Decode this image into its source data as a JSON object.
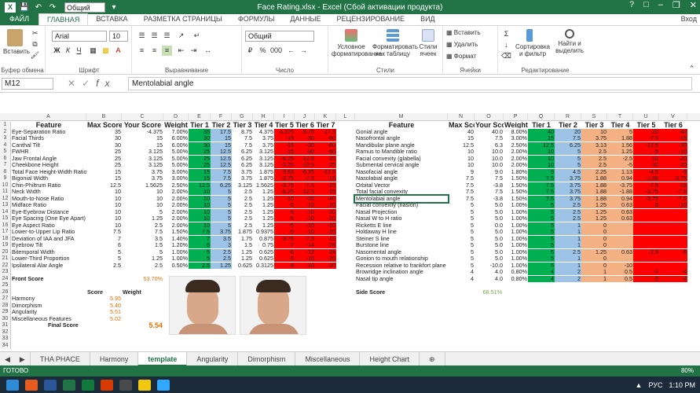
{
  "title": {
    "text": "Face Rating.xlsx - Excel (Сбой активации продукта)",
    "font_name": "Общий"
  },
  "tabs": {
    "file": "ФАЙЛ",
    "home": "ГЛАВНАЯ",
    "insert": "ВСТАВКА",
    "layout": "РАЗМЕТКА СТРАНИЦЫ",
    "formulas": "ФОРМУЛЫ",
    "data": "ДАННЫЕ",
    "review": "РЕЦЕНЗИРОВАНИЕ",
    "view": "ВИД",
    "login": "Вход"
  },
  "ribbon": {
    "paste": "Вставить",
    "clipboard": "Буфер обмена",
    "font_group": "Шрифт",
    "font": "Arial",
    "size": "10",
    "align": "Выравнивание",
    "numfmt": "Общий",
    "number": "Число",
    "cond": "Условное форматирование",
    "table": "Форматировать как таблицу",
    "styles_btn": "Стили ячеек",
    "styles": "Стили",
    "ins": "Вставить",
    "del": "Удалить",
    "fmt": "Формат",
    "cells": "Ячейки",
    "sort": "Сортировка и фильтр",
    "find": "Найти и выделить",
    "edit": "Редактирование"
  },
  "formula_bar": {
    "namebox": "M12",
    "formula": "Mentolabial angle"
  },
  "columns": [
    "A",
    "B",
    "C",
    "D",
    "E",
    "F",
    "G",
    "H",
    "I",
    "J",
    "K",
    "L",
    "M",
    "N",
    "O",
    "P",
    "Q",
    "R",
    "S",
    "T",
    "U",
    "V"
  ],
  "left_headers": [
    "Feature",
    "Max Score",
    "Your Score",
    "Weight",
    "Tier 1",
    "Tier 2",
    "Tier 3",
    "Tier 4",
    "Tier 5",
    "Tier 6",
    "Tier 7"
  ],
  "left_rows": [
    [
      "Eye-Separation Ratio",
      "35",
      "-4.375",
      "7.00%",
      "35",
      "17.5",
      "8.75",
      "4.375",
      "-4.375",
      "-8.75",
      "-17.5"
    ],
    [
      "Facial Thirds",
      "30",
      "15",
      "6.00%",
      "30",
      "15",
      "7.5",
      "3.75",
      "-15",
      "-30",
      "-60"
    ],
    [
      "Canthal Tilt",
      "30",
      "15",
      "6.00%",
      "30",
      "15",
      "7.5",
      "3.75",
      "-15",
      "-30",
      "-60"
    ],
    [
      "FWHR",
      "25",
      "3.125",
      "5.00%",
      "25",
      "12.5",
      "6.25",
      "3.125",
      "-15",
      "-30",
      "-60"
    ],
    [
      "Jaw Frontal Angle",
      "25",
      "3.125",
      "5.00%",
      "25",
      "12.5",
      "6.25",
      "3.125",
      "-6.25",
      "-12.5",
      "-25"
    ],
    [
      "Cheekbone Height",
      "25",
      "3.125",
      "5.00%",
      "25",
      "12.5",
      "6.25",
      "3.125",
      "-3.25",
      "-12.5",
      "-25"
    ],
    [
      "Total Face Height-Width Ratio",
      "15",
      "3.75",
      "3.00%",
      "15",
      "7.5",
      "3.75",
      "1.875",
      "-3.63",
      "-6.25",
      "-12.5"
    ],
    [
      "Bigonial Width",
      "15",
      "3.75",
      "3.00%",
      "15",
      "7.5",
      "3.75",
      "1.875",
      "-3.75",
      "-7.5",
      "-15"
    ],
    [
      "Chin-Philtrum Ratio",
      "12.5",
      "1.5625",
      "2.50%",
      "12.5",
      "6.25",
      "3.125",
      "1.5625",
      "-3.75",
      "-7.5",
      "-15"
    ],
    [
      "Neck Width",
      "10",
      "10",
      "2.00%",
      "10",
      "5",
      "2.5",
      "1.25",
      "-6.25",
      "-12.5",
      "-25"
    ],
    [
      "Mouth-to-Nose Ratio",
      "10",
      "10",
      "2.00%",
      "10",
      "5",
      "2.5",
      "1.25",
      "-10",
      "-20",
      "-40"
    ],
    [
      "Midface Ratio",
      "10",
      "10",
      "2.00%",
      "10",
      "5",
      "2.5",
      "1.25",
      "-5",
      "-10",
      "-20"
    ],
    [
      "Eye-Eyebrow Distance",
      "10",
      "5",
      "2.00%",
      "10",
      "5",
      "2.5",
      "1.25",
      "-5",
      "-10",
      "-20"
    ],
    [
      "Eye Spacing (One Eye Apart)",
      "10",
      "1.25",
      "2.00%",
      "10",
      "5",
      "2.5",
      "1.25",
      "-5",
      "-10",
      "-20"
    ],
    [
      "Eye Aspect Ratio",
      "10",
      "2.5",
      "2.00%",
      "10",
      "5",
      "2.5",
      "1.25",
      "-5",
      "-10",
      "-20"
    ],
    [
      "Lower-to-Upper Lip Ratio",
      "7.5",
      "7.5",
      "1.50%",
      "7.5",
      "3.75",
      "1.875",
      "0.9375",
      "-5",
      "-10",
      "-20"
    ],
    [
      "Deviation of IAA and JFA",
      "7",
      "3.5",
      "1.40%",
      "7",
      "3.5",
      "1.75",
      "0.875",
      "-3.75",
      "-7.5",
      "-15"
    ],
    [
      "Eyebrow Tilt",
      "6",
      "1.5",
      "1.20%",
      "6",
      "3",
      "1.5",
      "0.75",
      "-7",
      "-14",
      "-28"
    ],
    [
      "Bitemporal Width",
      "5",
      "5",
      "1.00%",
      "5",
      "2.5",
      "1.25",
      "0.625",
      "-6",
      "-12",
      "-24"
    ],
    [
      "Lower-Third Proportion",
      "5",
      "1.25",
      "1.00%",
      "5",
      "2.5",
      "1.25",
      "0.625",
      "-5",
      "-10",
      "-20"
    ],
    [
      "Ipsilateral Alar Angle",
      "2.5",
      "2.5",
      "0.50%",
      "2.5",
      "1.25",
      "0.625",
      "0.3125",
      "-5",
      "-10",
      "-20"
    ]
  ],
  "front_score": {
    "label": "Front Score",
    "value": "53.70%"
  },
  "summary": {
    "score_h": "Score",
    "weight_h": "Weight",
    "rows": [
      [
        "Harmony",
        "5.95",
        "35%"
      ],
      [
        "Dimorphism",
        "5.40",
        "20%"
      ],
      [
        "Angularity",
        "5.51",
        "25%"
      ],
      [
        "Miscellaneous Features",
        "5.02",
        "20%"
      ]
    ],
    "final_label": "Final Score",
    "final_value": "5.54"
  },
  "right_headers": [
    "Feature",
    "Max Score",
    "Your Score",
    "Weight",
    "Tier 1",
    "Tier 2",
    "Tier 3",
    "Tier 4",
    "Tier 5",
    "Tier 6"
  ],
  "right_rows": [
    [
      "Gonial angle",
      "40",
      "40.0",
      "8.00%",
      "40",
      "20",
      "10",
      "5",
      "-20",
      "-40"
    ],
    [
      "Nasofrontal angle",
      "15",
      "7.5",
      "3.00%",
      "15",
      "7.5",
      "3.75",
      "1.88",
      "-7.5",
      "-15"
    ],
    [
      "Mandibular plane angle",
      "12.5",
      "6.3",
      "2.50%",
      "12.5",
      "6.25",
      "3.13",
      "1.56",
      "-12.5",
      "-20"
    ],
    [
      "Ramus to Mandible ratio",
      "10",
      "10.0",
      "2.00%",
      "10",
      "5",
      "2.5",
      "1.25",
      "-5",
      "-10"
    ],
    [
      "Facial convexity (glabella)",
      "10",
      "10.0",
      "2.00%",
      "10",
      "5",
      "2.5",
      "-2.5",
      "-10",
      "-20"
    ],
    [
      "Submental cervical angle",
      "10",
      "10.0",
      "2.00%",
      "10",
      "5",
      "2.5",
      "-5",
      "-10",
      "-20"
    ],
    [
      "Nasofacial angle",
      "9",
      "9.0",
      "1.80%",
      "9",
      "4.5",
      "2.25",
      "1.13",
      "-4.5",
      "-9"
    ],
    [
      "Nasolabial angle",
      "7.5",
      "7.5",
      "1.50%",
      "7.5",
      "3.75",
      "1.88",
      "0.94",
      "-1.88",
      "-3.75"
    ],
    [
      "Orbital Vector",
      "7.5",
      "-3.8",
      "1.50%",
      "7.5",
      "3.75",
      "1.88",
      "-3.75",
      "-7.5",
      "-15"
    ],
    [
      "Total facial convexity",
      "7.5",
      "7.5",
      "1.50%",
      "7.5",
      "3.75",
      "1.88",
      "-1.88",
      "-3.75",
      "-7.5"
    ],
    [
      "Mentolabial angle",
      "7.5",
      "-3.8",
      "1.50%",
      "7.5",
      "3.75",
      "1.88",
      "0.94",
      "-3.75",
      "-7.5"
    ],
    [
      "Facial convexity (nasion)",
      "5",
      "5.0",
      "1.00%",
      "5",
      "2.5",
      "1.25",
      "0.63",
      "-5",
      "-10"
    ],
    [
      "Nasal Projection",
      "5",
      "5.0",
      "1.00%",
      "5",
      "2.5",
      "1.25",
      "0.63",
      "",
      ""
    ],
    [
      "Nasal W to H ratio",
      "5",
      "5.0",
      "1.00%",
      "5",
      "2.5",
      "1.25",
      "0.63",
      "",
      ""
    ],
    [
      "Ricketts E line",
      "5",
      "0.0",
      "1.00%",
      "5",
      "1",
      "0",
      "",
      "",
      ""
    ],
    [
      "Holdaway H line",
      "5",
      "5.0",
      "1.00%",
      "5",
      "1",
      "0",
      "",
      "",
      ""
    ],
    [
      "Steiner S line",
      "5",
      "5.0",
      "1.00%",
      "5",
      "1",
      "0",
      "",
      "",
      ""
    ],
    [
      "Burstone line",
      "5",
      "5.0",
      "1.00%",
      "5",
      "1",
      "0",
      "",
      "",
      ""
    ],
    [
      "Nasomental angle",
      "5",
      "5.0",
      "1.00%",
      "5",
      "2.5",
      "1.25",
      "0.63",
      "-2.5",
      "-5"
    ],
    [
      "Gonion to mouth relationship",
      "5",
      "5.0",
      "1.00%",
      "5",
      "1",
      "0",
      "",
      "",
      ""
    ],
    [
      "Recession relative to frankfort plane",
      "5",
      "-10.0",
      "1.00%",
      "5",
      "1",
      "0",
      "-10",
      "",
      ""
    ],
    [
      "Browridge inclination angle",
      "4",
      "4.0",
      "0.80%",
      "4",
      "2",
      "1",
      "0.5",
      "-2",
      "-4"
    ],
    [
      "Nasal tip angle",
      "4",
      "4.0",
      "0.80%",
      "4",
      "2",
      "1",
      "0.5",
      "-2",
      "-4"
    ]
  ],
  "side_score": {
    "label": "Side Score",
    "value": "68.51%"
  },
  "sheets": [
    "THA PHACE",
    "Harmony",
    "template",
    "Angularity",
    "Dimorphism",
    "Miscellaneous",
    "Height Chart"
  ],
  "status": {
    "ready": "ГОТОВО",
    "zoom": "80%"
  },
  "taskbar": {
    "lang": "РУС",
    "time": "1:10 PM"
  },
  "colors": {
    "green": "#00b050",
    "lightgreen": "#92d050",
    "blue": "#9dc3e6",
    "peach": "#f4b183",
    "red": "#ff0000",
    "accent": "#217346"
  },
  "icons": [
    "save-icon",
    "undo-icon",
    "redo-icon",
    "paste-icon",
    "bold-icon",
    "italic-icon",
    "underline-icon",
    "minimize-icon",
    "restore-icon",
    "close-icon",
    "windows-start-icon"
  ]
}
